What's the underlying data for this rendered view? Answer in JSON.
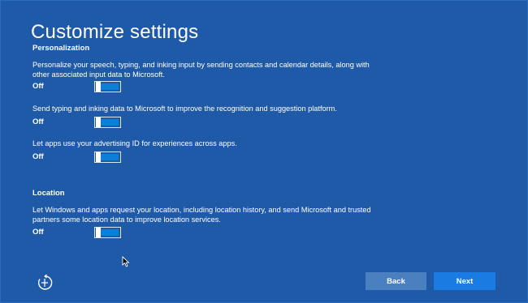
{
  "page": {
    "title": "Customize settings"
  },
  "personalization": {
    "heading": "Personalization",
    "settings": [
      {
        "description": "Personalize your speech, typing, and inking input by sending contacts and calendar details, along with other associated input data to Microsoft.",
        "state_label": "Off",
        "on": false
      },
      {
        "description": "Send typing and inking data to Microsoft to improve the recognition and suggestion platform.",
        "state_label": "Off",
        "on": false
      },
      {
        "description": "Let apps use your advertising ID for experiences across apps.",
        "state_label": "Off",
        "on": false
      }
    ]
  },
  "location": {
    "heading": "Location",
    "settings": [
      {
        "description": "Let Windows and apps request your location, including location history, and send Microsoft and trusted partners some location data to improve location services.",
        "state_label": "Off",
        "on": false
      }
    ]
  },
  "footer": {
    "back_label": "Back",
    "next_label": "Next",
    "ease_of_access_icon": "ease-of-access-icon"
  },
  "colors": {
    "background": "#1f5aa8",
    "toggle_track": "#0e7fd6",
    "back_button": "#4a7fc0",
    "next_button": "#1a7be2"
  }
}
